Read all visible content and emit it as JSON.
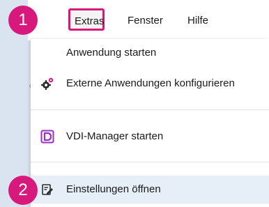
{
  "menubar": {
    "items": [
      {
        "label": "Extras"
      },
      {
        "label": "Fenster"
      },
      {
        "label": "Hilfe"
      }
    ]
  },
  "callouts": [
    "1",
    "2"
  ],
  "dropdown": {
    "items": [
      {
        "label": "Anwendung starten",
        "icon": "none"
      },
      {
        "label": "Externe Anwendungen konfigurieren",
        "icon": "gears-icon"
      },
      {
        "label": "VDI-Manager starten",
        "icon": "vdi-d-icon"
      },
      {
        "label": "Einstellungen öffnen",
        "icon": "settings-edit-icon"
      }
    ]
  },
  "colors": {
    "highlight": "#d6197a",
    "hover_row": "#e6eff8",
    "vdi_icon": "#9b2fc1"
  }
}
